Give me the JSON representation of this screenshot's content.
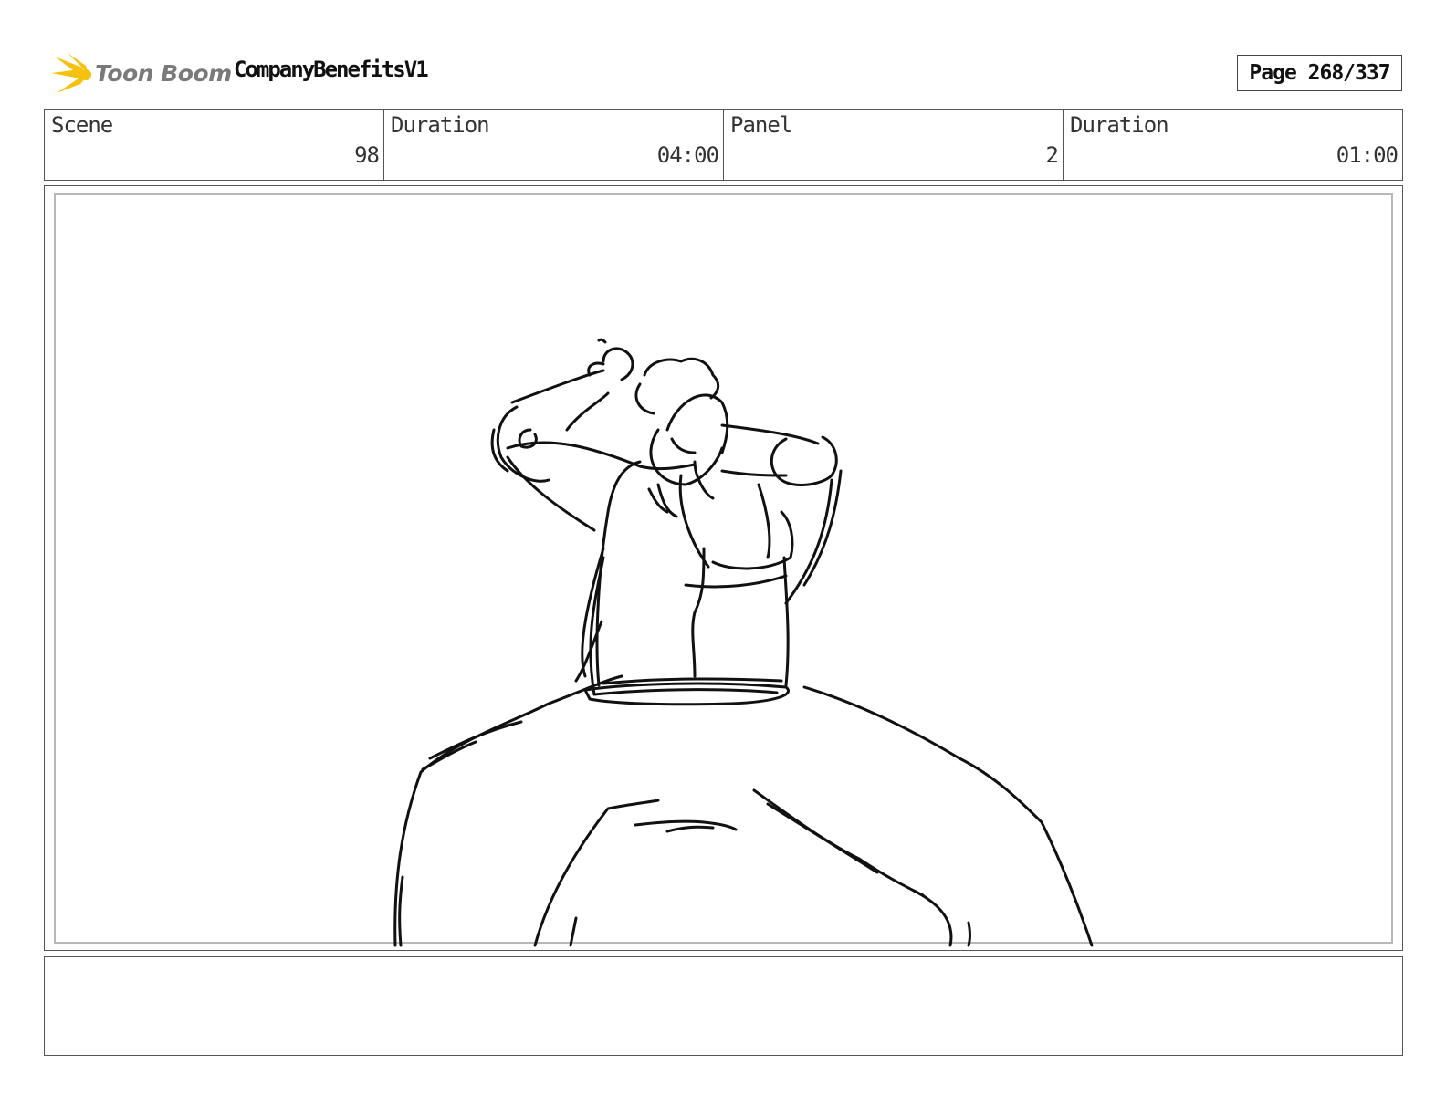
{
  "header": {
    "logo_text": "Toon Boom",
    "project_title": "CompanyBenefitsV1",
    "page_label": "Page 268/337"
  },
  "info": {
    "scene_label": "Scene",
    "scene_value": "98",
    "scene_duration_label": "Duration",
    "scene_duration_value": "04:00",
    "panel_label": "Panel",
    "panel_value": "2",
    "panel_duration_label": "Duration",
    "panel_duration_value": "01:00"
  },
  "notes": {
    "text": ""
  }
}
